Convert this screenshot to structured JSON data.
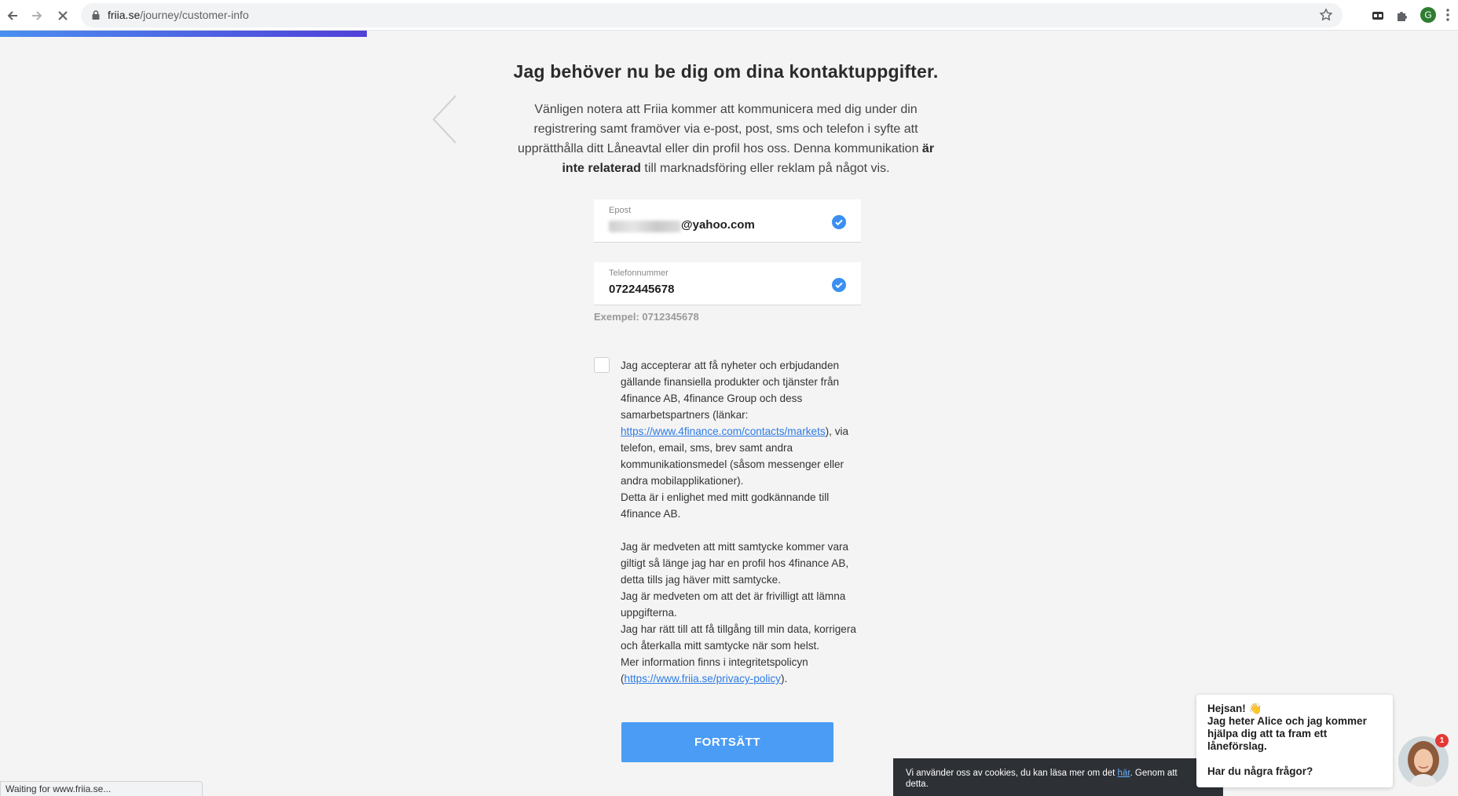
{
  "browser": {
    "url_host": "friia.se",
    "url_path": "/journey/customer-info",
    "profile_initial": "G",
    "status_text": "Waiting for www.friia.se..."
  },
  "progress": {
    "fraction": 0.2516
  },
  "page": {
    "title": "Jag behöver nu be dig om dina kontaktuppgifter.",
    "notice_part1": "Vänligen notera att Friia kommer att kommunicera med dig under din registrering samt framöver via e-post, post, sms och telefon i syfte att upprätthålla ditt Låneavtal eller din profil hos oss. Denna kommunikation ",
    "notice_bold": "är inte relaterad",
    "notice_part2": " till marknadsföring eller reklam på något vis."
  },
  "form": {
    "email": {
      "label": "Epost",
      "value_suffix": "@yahoo.com"
    },
    "phone": {
      "label": "Telefonnummer",
      "value": "0722445678"
    },
    "example": "Exempel: 0712345678",
    "consent": {
      "p1_a": "Jag accepterar att få nyheter och erbjudanden gällande finansiella produkter och tjänster från 4finance AB, 4finance Group och dess samarbetspartners (länkar: ",
      "p1_link": "https://www.4finance.com/contacts/markets",
      "p1_b": "), via telefon, email, sms, brev samt andra kommunikationsmedel (såsom messenger eller andra mobilapplikationer).",
      "p2": "Detta är i enlighet med mitt godkännande till 4finance AB.",
      "p3": "Jag är medveten att mitt samtycke kommer vara giltigt så länge jag har en profil hos 4finance AB, detta tills jag häver mitt samtycke.",
      "p4": "Jag är medveten om att det är frivilligt att lämna uppgifterna.",
      "p5": "Jag har rätt till att få tillgång till min data, korrigera och återkalla mitt samtycke när som helst.",
      "p6": "Mer information finns i integritetspolicyn",
      "p7_open": "(",
      "p7_link": "https://www.friia.se/privacy-policy",
      "p7_close": ")."
    },
    "submit_label": "FORTSÄTT"
  },
  "cookie": {
    "text_a": "Vi använder oss av cookies, du kan läsa mer om det ",
    "link": "här",
    "text_b": ". Genom att",
    "text_c": "detta."
  },
  "chat": {
    "greeting": "Hejsan! 👋",
    "intro": "Jag heter Alice och jag kommer hjälpa dig att ta fram ett låneförslag.",
    "question": "Har du några frågor?",
    "badge_count": "1"
  },
  "colors": {
    "accent": "#4a9cf5",
    "link": "#2d7be5",
    "check": "#3a8ff2",
    "progress_start": "#4a8ff0",
    "progress_end": "#5140d8"
  },
  "icons": {
    "back": "arrow-left-icon",
    "forward": "arrow-right-icon",
    "stop": "close-icon",
    "lock": "lock-icon",
    "bookmark": "star-icon",
    "extension": "puzzle-icon",
    "check": "check-circle-icon",
    "page_back": "chevron-left-icon"
  }
}
